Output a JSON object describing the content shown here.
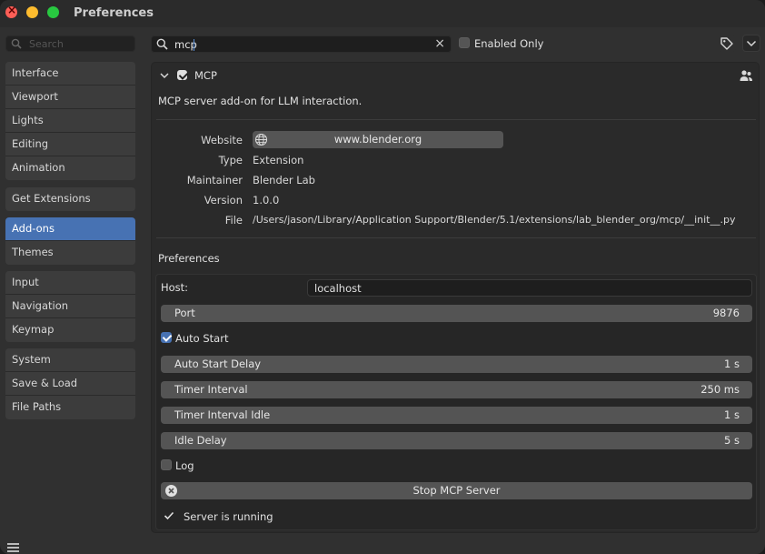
{
  "window": {
    "title": "Preferences"
  },
  "sidebar": {
    "search_placeholder": "Search",
    "groups": [
      [
        "Interface",
        "Viewport",
        "Lights",
        "Editing",
        "Animation"
      ],
      [
        "Get Extensions"
      ],
      [
        "Add-ons",
        "Themes"
      ],
      [
        "Input",
        "Navigation",
        "Keymap"
      ],
      [
        "System",
        "Save & Load",
        "File Paths"
      ]
    ],
    "active": "Add-ons"
  },
  "toolbar": {
    "search_value": "mcp",
    "enabled_only_label": "Enabled Only",
    "enabled_only_checked": false
  },
  "addon": {
    "name": "MCP",
    "enabled": true,
    "description": "MCP server add-on for LLM interaction.",
    "info": {
      "website_label": "Website",
      "website_value": "www.blender.org",
      "type_label": "Type",
      "type_value": "Extension",
      "maintainer_label": "Maintainer",
      "maintainer_value": "Blender Lab",
      "version_label": "Version",
      "version_value": "1.0.0",
      "file_label": "File",
      "file_value": "/Users/jason/Library/Application Support/Blender/5.1/extensions/lab_blender_org/mcp/__init__.py"
    },
    "preferences": {
      "heading": "Preferences",
      "host_label": "Host:",
      "host_value": "localhost",
      "port_label": "Port",
      "port_value": "9876",
      "auto_start_label": "Auto Start",
      "auto_start_checked": true,
      "auto_start_delay_label": "Auto Start Delay",
      "auto_start_delay_value": "1 s",
      "timer_interval_label": "Timer Interval",
      "timer_interval_value": "250 ms",
      "timer_interval_idle_label": "Timer Interval Idle",
      "timer_interval_idle_value": "1 s",
      "idle_delay_label": "Idle Delay",
      "idle_delay_value": "5 s",
      "log_label": "Log",
      "log_checked": false,
      "stop_button_label": "Stop MCP Server",
      "status_text": "Server is running"
    }
  },
  "colors": {
    "accent": "#4772b3",
    "background": "#303030",
    "panel": "#2a2a2a",
    "slider": "#545454"
  }
}
